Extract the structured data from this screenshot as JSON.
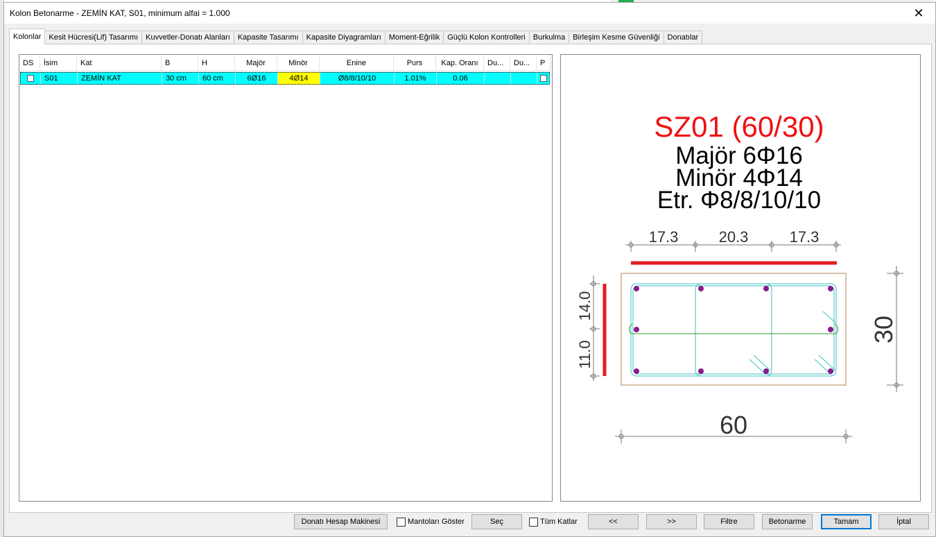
{
  "window": {
    "title": "Kolon Betonarme - ZEMİN KAT, S01, minimum alfai = 1.000",
    "close_glyph": "✕"
  },
  "tabs": [
    "Kolonlar",
    "Kesit Hücresi(Lif) Tasarımı",
    "Kuvvetler-Donatı Alanları",
    "Kapasite Tasarımı",
    "Kapasite Diyagramları",
    "Moment-Eğrilik",
    "Güçlü Kolon Kontrolleri",
    "Burkulma",
    "Birleşim Kesme Güvenliği",
    "Donatılar"
  ],
  "active_tab": 0,
  "grid": {
    "columns": [
      "DS",
      "İsim",
      "Kat",
      "B",
      "H",
      "Majör",
      "Minör",
      "Enine",
      "Purs",
      "Kap. Oranı",
      "Du...",
      "Du...",
      "P"
    ],
    "row": {
      "isim": "S01",
      "kat": "ZEMİN KAT",
      "b": "30 cm",
      "h": "60 cm",
      "major": "6Ø16",
      "minor": "4Ø14",
      "enine": "Ø8/8/10/10",
      "purs": "1.01%",
      "kap_orani": "0.06",
      "du1": "",
      "du2": ""
    },
    "row_color": "#00ffff",
    "highlight_color": "#ffff00"
  },
  "drawing": {
    "section_title": "SZ01 (60/30)",
    "major_text": "Majör 6Φ16",
    "minor_text": "Minör 4Φ14",
    "stirrup_text": "Etr. Φ8/8/10/10",
    "top_dims": [
      "17.3",
      "20.3",
      "17.3"
    ],
    "left_dims": [
      "14.0",
      "11.0"
    ],
    "width_dim": "60",
    "height_dim": "30",
    "title_color": "#ee1111",
    "bar_color": "#8b1a8b",
    "stirrup_color": "#3cc0c0",
    "highlight_line_color": "#e31e24"
  },
  "buttons": {
    "calculator": "Donatı Hesap Makinesi",
    "show_jackets": "Mantoları Göster",
    "select": "Seç",
    "all_floors": "Tüm Katlar",
    "prev": "<<",
    "next": ">>",
    "filter": "Filtre",
    "concrete": "Betonarme",
    "ok": "Tamam",
    "cancel": "İptal"
  }
}
